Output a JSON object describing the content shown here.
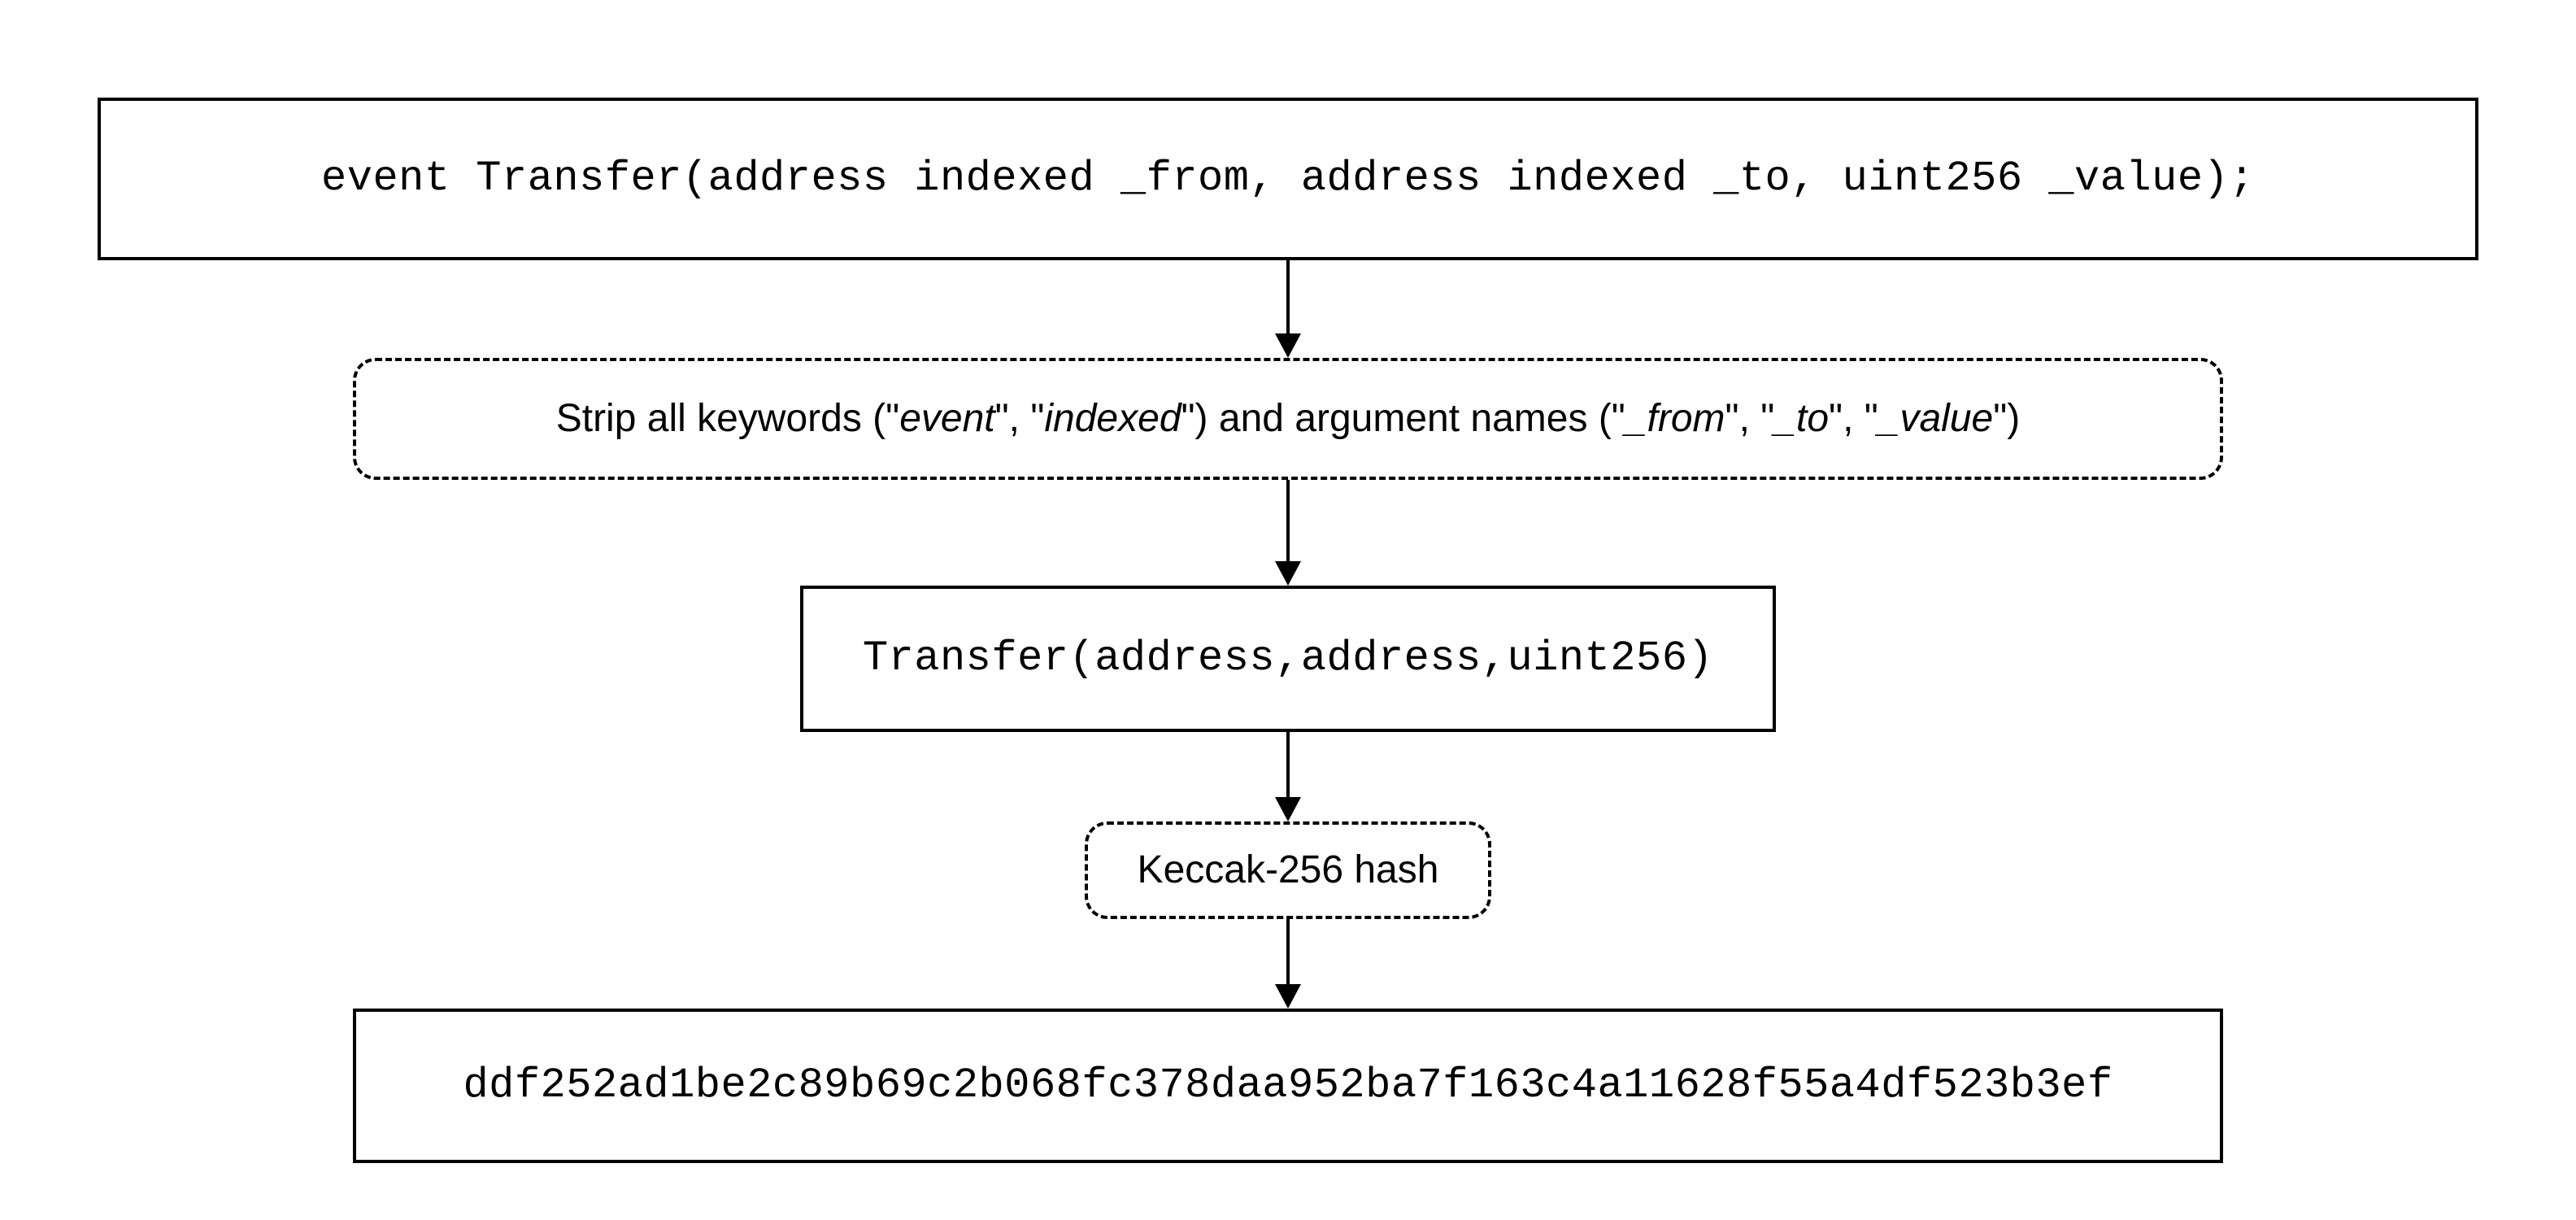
{
  "diagram": {
    "type": "flowchart",
    "direction": "top-to-bottom",
    "nodes": [
      {
        "id": "source",
        "style": "solid",
        "font": "mono",
        "text": "event Transfer(address indexed _from, address indexed _to, uint256 _value);"
      },
      {
        "id": "strip",
        "style": "dashed",
        "font": "sans",
        "segments": [
          {
            "t": "Strip all keywords (\"",
            "it": false
          },
          {
            "t": "event",
            "it": true
          },
          {
            "t": "\", \"",
            "it": false
          },
          {
            "t": "indexed",
            "it": true
          },
          {
            "t": "\") and argument names (\"",
            "it": false
          },
          {
            "t": "_from",
            "it": true
          },
          {
            "t": "\", \"",
            "it": false
          },
          {
            "t": "_to",
            "it": true
          },
          {
            "t": "\", \"",
            "it": false
          },
          {
            "t": "_value",
            "it": true
          },
          {
            "t": "\")",
            "it": false
          }
        ]
      },
      {
        "id": "canonical",
        "style": "solid",
        "font": "mono",
        "text": "Transfer(address,address,uint256)"
      },
      {
        "id": "hash",
        "style": "dashed",
        "font": "sans",
        "text": "Keccak-256 hash"
      },
      {
        "id": "digest",
        "style": "solid",
        "font": "mono",
        "text": "ddf252ad1be2c89b69c2b068fc378daa952ba7f163c4a11628f55a4df523b3ef"
      }
    ],
    "edges": [
      {
        "from": "source",
        "to": "strip"
      },
      {
        "from": "strip",
        "to": "canonical"
      },
      {
        "from": "canonical",
        "to": "hash"
      },
      {
        "from": "hash",
        "to": "digest"
      }
    ]
  }
}
